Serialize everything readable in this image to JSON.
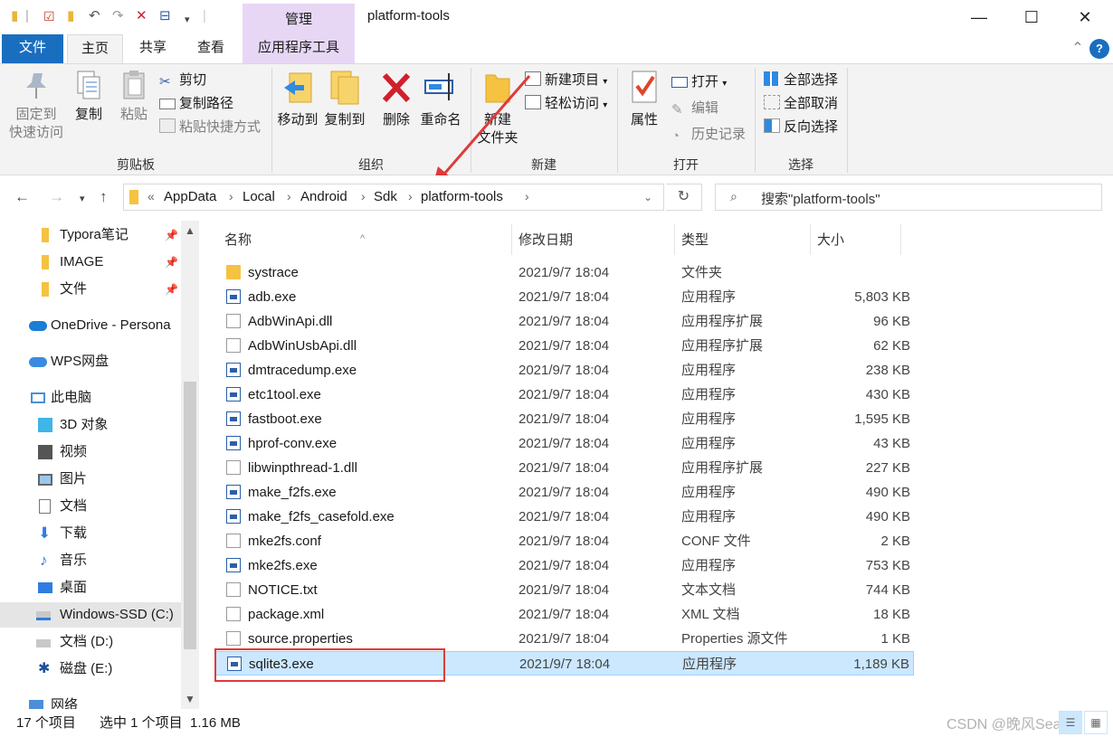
{
  "window": {
    "title": "platform-tools",
    "context_tab": "管理",
    "controls": [
      "—",
      "☐",
      "✕"
    ]
  },
  "ribbon_tabs": [
    "文件",
    "主页",
    "共享",
    "查看",
    "应用程序工具"
  ],
  "ribbon": {
    "clipboard": {
      "pin_line1": "固定到",
      "pin_line2": "快速访问",
      "copy": "复制",
      "paste": "粘贴",
      "cut": "剪切",
      "copy_path": "复制路径",
      "paste_shortcut": "粘贴快捷方式",
      "label": "剪贴板"
    },
    "organize": {
      "move_to": "移动到",
      "copy_to": "复制到",
      "delete": "删除",
      "rename": "重命名",
      "label": "组织"
    },
    "new": {
      "new_folder_line1": "新建",
      "new_folder_line2": "文件夹",
      "new_item": "新建项目",
      "easy_access": "轻松访问",
      "label": "新建"
    },
    "open": {
      "properties": "属性",
      "open": "打开",
      "edit": "编辑",
      "history": "历史记录",
      "label": "打开"
    },
    "select": {
      "select_all": "全部选择",
      "select_none": "全部取消",
      "invert": "反向选择",
      "label": "选择"
    }
  },
  "address": {
    "prefix": "«",
    "crumbs": [
      "AppData",
      "Local",
      "Android",
      "Sdk",
      "platform-tools"
    ],
    "search_placeholder": "搜索\"platform-tools\""
  },
  "nav_pane": [
    {
      "label": "Typora笔记",
      "pinned": true
    },
    {
      "label": "IMAGE",
      "pinned": true
    },
    {
      "label": "文件",
      "pinned": true
    },
    {
      "label": "OneDrive - Persona"
    },
    {
      "label": "WPS网盘"
    },
    {
      "label": "此电脑"
    },
    {
      "label": "3D 对象"
    },
    {
      "label": "视频"
    },
    {
      "label": "图片"
    },
    {
      "label": "文档"
    },
    {
      "label": "下载"
    },
    {
      "label": "音乐"
    },
    {
      "label": "桌面"
    },
    {
      "label": "Windows-SSD (C:)"
    },
    {
      "label": "文档 (D:)"
    },
    {
      "label": "磁盘 (E:)"
    },
    {
      "label": "网络"
    }
  ],
  "columns": [
    "名称",
    "修改日期",
    "类型",
    "大小"
  ],
  "files": [
    {
      "name": "systrace",
      "date": "2021/9/7 18:04",
      "type": "文件夹",
      "size": "",
      "kind": "folder"
    },
    {
      "name": "adb.exe",
      "date": "2021/9/7 18:04",
      "type": "应用程序",
      "size": "5,803 KB",
      "kind": "exe"
    },
    {
      "name": "AdbWinApi.dll",
      "date": "2021/9/7 18:04",
      "type": "应用程序扩展",
      "size": "96 KB",
      "kind": "dll"
    },
    {
      "name": "AdbWinUsbApi.dll",
      "date": "2021/9/7 18:04",
      "type": "应用程序扩展",
      "size": "62 KB",
      "kind": "dll"
    },
    {
      "name": "dmtracedump.exe",
      "date": "2021/9/7 18:04",
      "type": "应用程序",
      "size": "238 KB",
      "kind": "exe"
    },
    {
      "name": "etc1tool.exe",
      "date": "2021/9/7 18:04",
      "type": "应用程序",
      "size": "430 KB",
      "kind": "exe"
    },
    {
      "name": "fastboot.exe",
      "date": "2021/9/7 18:04",
      "type": "应用程序",
      "size": "1,595 KB",
      "kind": "exe"
    },
    {
      "name": "hprof-conv.exe",
      "date": "2021/9/7 18:04",
      "type": "应用程序",
      "size": "43 KB",
      "kind": "exe"
    },
    {
      "name": "libwinpthread-1.dll",
      "date": "2021/9/7 18:04",
      "type": "应用程序扩展",
      "size": "227 KB",
      "kind": "dll"
    },
    {
      "name": "make_f2fs.exe",
      "date": "2021/9/7 18:04",
      "type": "应用程序",
      "size": "490 KB",
      "kind": "exe"
    },
    {
      "name": "make_f2fs_casefold.exe",
      "date": "2021/9/7 18:04",
      "type": "应用程序",
      "size": "490 KB",
      "kind": "exe"
    },
    {
      "name": "mke2fs.conf",
      "date": "2021/9/7 18:04",
      "type": "CONF 文件",
      "size": "2 KB",
      "kind": "txt"
    },
    {
      "name": "mke2fs.exe",
      "date": "2021/9/7 18:04",
      "type": "应用程序",
      "size": "753 KB",
      "kind": "exe"
    },
    {
      "name": "NOTICE.txt",
      "date": "2021/9/7 18:04",
      "type": "文本文档",
      "size": "744 KB",
      "kind": "txt"
    },
    {
      "name": "package.xml",
      "date": "2021/9/7 18:04",
      "type": "XML 文档",
      "size": "18 KB",
      "kind": "txt"
    },
    {
      "name": "source.properties",
      "date": "2021/9/7 18:04",
      "type": "Properties 源文件",
      "size": "1 KB",
      "kind": "txt"
    },
    {
      "name": "sqlite3.exe",
      "date": "2021/9/7 18:04",
      "type": "应用程序",
      "size": "1,189 KB",
      "kind": "exe",
      "selected": true
    }
  ],
  "status": {
    "count": "17 个项目",
    "selection": "选中 1 个项目  1.16 MB"
  },
  "watermark": "CSDN @晚风Search",
  "colors": {
    "file_tab": "#1a6ec0",
    "context_tab": "#e7d7f5",
    "selection": "#cce8ff",
    "annotation": "#e03a3a"
  }
}
